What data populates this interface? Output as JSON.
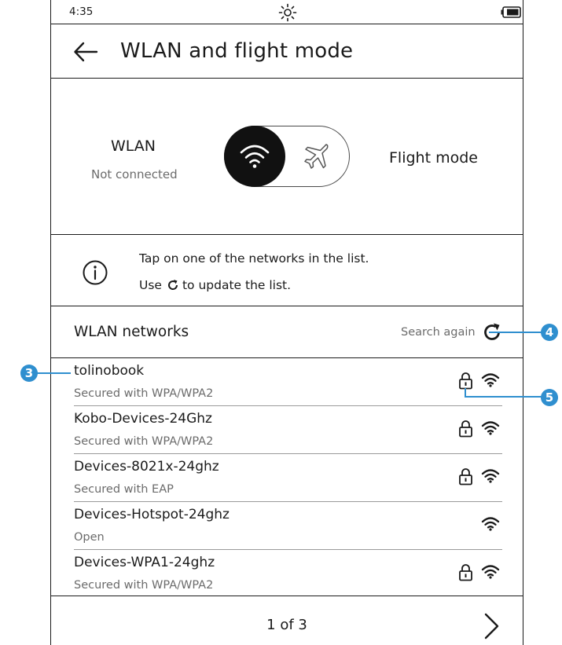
{
  "status_bar": {
    "time": "4:35",
    "light_icon": "brightness-sun-icon",
    "battery_icon": "battery-icon"
  },
  "header": {
    "back_icon": "arrow-left-icon",
    "title": "WLAN and flight mode"
  },
  "mode": {
    "wlan_label": "WLAN",
    "wlan_status": "Not connected",
    "toggle_selected": "WLAN",
    "flight_label": "Flight mode"
  },
  "info": {
    "line1": "Tap on one of the networks in the list.",
    "line2_before": "Use",
    "line2_after": "to update the list."
  },
  "networks": {
    "title": "WLAN networks",
    "search_again": "Search again",
    "items": [
      {
        "name": "tolinobook",
        "security": "Secured with WPA/WPA2",
        "locked": true
      },
      {
        "name": "Kobo-Devices-24Ghz",
        "security": "Secured with WPA/WPA2",
        "locked": true
      },
      {
        "name": "Devices-8021x-24ghz",
        "security": "Secured with EAP",
        "locked": true
      },
      {
        "name": "Devices-Hotspot-24ghz",
        "security": "Open",
        "locked": false
      },
      {
        "name": "Devices-WPA1-24ghz",
        "security": "Secured with WPA/WPA2",
        "locked": true
      }
    ]
  },
  "footer": {
    "page_indicator": "1 of 3",
    "next_icon": "chevron-right-icon"
  },
  "callouts": {
    "c3": "3",
    "c4": "4",
    "c5": "5"
  },
  "colors": {
    "callout": "#2f8fcf",
    "text": "#1a1a1a",
    "secondary_text": "#6b6b6b"
  }
}
